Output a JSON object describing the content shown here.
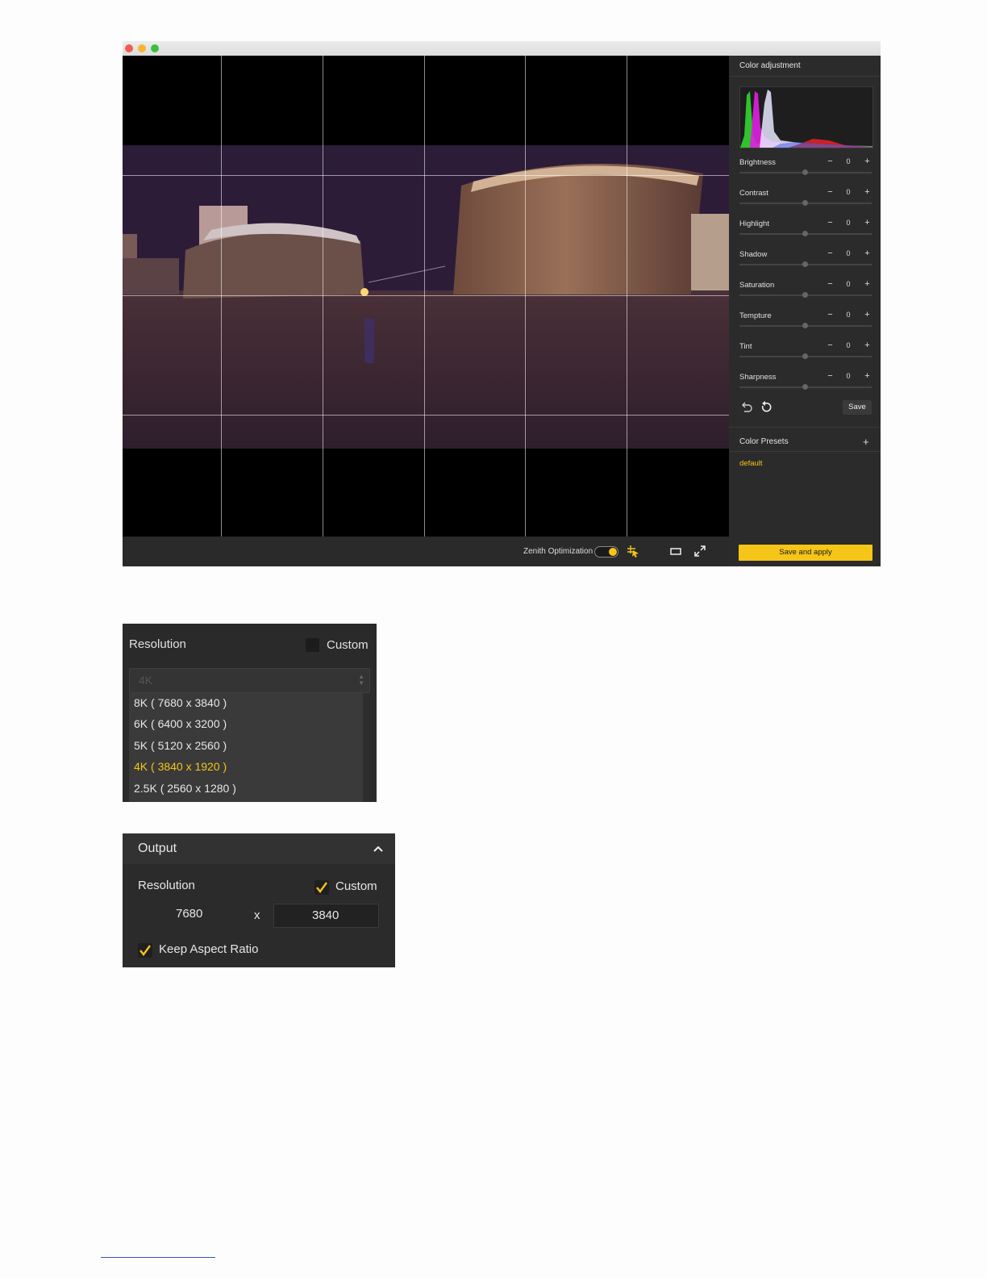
{
  "viewer": {
    "zenith_label": "Zenith Optimization",
    "zenith_enabled": true
  },
  "panel": {
    "title": "Color adjustment",
    "adjustments": [
      {
        "label": "Brightness",
        "value": "0"
      },
      {
        "label": "Contrast",
        "value": "0"
      },
      {
        "label": "Highlight",
        "value": "0"
      },
      {
        "label": "Shadow",
        "value": "0"
      },
      {
        "label": "Saturation",
        "value": "0"
      },
      {
        "label": "Tempture",
        "value": "0"
      },
      {
        "label": "Tint",
        "value": "0"
      },
      {
        "label": "Sharpness",
        "value": "0"
      }
    ],
    "save_label": "Save",
    "presets_title": "Color Presets",
    "preset_default": "default",
    "apply_label": "Save and apply"
  },
  "resolution_panel": {
    "label": "Resolution",
    "custom_label": "Custom",
    "custom_checked": false,
    "select_value": "4K",
    "options": [
      {
        "label": "8K ( 7680 x 3840 )",
        "selected": false
      },
      {
        "label": "6K ( 6400 x 3200 )",
        "selected": false
      },
      {
        "label": "5K ( 5120 x 2560 )",
        "selected": false
      },
      {
        "label": "4K ( 3840 x 1920 )",
        "selected": true
      },
      {
        "label": "2.5K ( 2560 x 1280 )",
        "selected": false
      }
    ]
  },
  "output_panel": {
    "title": "Output",
    "resolution_label": "Resolution",
    "custom_label": "Custom",
    "custom_checked": true,
    "width": "7680",
    "separator": "x",
    "height": "3840",
    "keep_aspect_label": "Keep Aspect Ratio",
    "keep_aspect_checked": true
  },
  "colors": {
    "accent": "#f5c518",
    "panel_bg": "#2b2b2b",
    "viewer_bg": "#000000"
  },
  "icons": [
    "undo-icon",
    "reset-icon",
    "crosshair-select-icon",
    "aspect-rect-icon",
    "fullscreen-icon",
    "plus-icon",
    "minus-icon",
    "chevron-up-icon",
    "checkmark-icon"
  ]
}
